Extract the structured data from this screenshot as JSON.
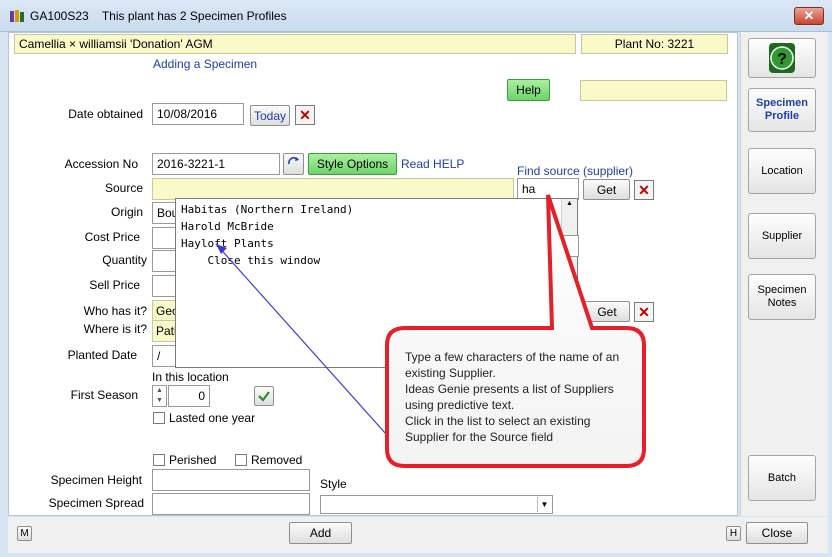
{
  "window": {
    "id": "GA100S23",
    "subtitle": "This plant has 2 Specimen Profiles",
    "close": "✕"
  },
  "header": {
    "plant_name": "Camellia × williamsii 'Donation' AGM",
    "plant_no": "Plant No: 3221",
    "mode": "Adding a Specimen"
  },
  "buttons": {
    "help": "Help",
    "today": "Today",
    "style_options": "Style Options",
    "get": "Get",
    "get2": "Get",
    "add": "Add",
    "close": "Close",
    "m": "M",
    "h": "H"
  },
  "fields": {
    "date_obtained": {
      "label": "Date obtained",
      "value": "10/08/2016"
    },
    "accession_no": {
      "label": "Accession No",
      "value": "2016-3221-1"
    },
    "source": {
      "label": "Source",
      "value": ""
    },
    "origin": {
      "label": "Origin",
      "value": "Bou"
    },
    "cost_price": {
      "label": "Cost Price",
      "value": ""
    },
    "quantity": {
      "label": "Quantity",
      "value": ""
    },
    "sell_price": {
      "label": "Sell Price",
      "value": ""
    },
    "who_has_it": {
      "label": "Who has it?",
      "value": "Geo"
    },
    "where_is_it": {
      "label": "Where is it?",
      "value": "Pati"
    },
    "planted_date": {
      "label": "Planted Date",
      "value": "/"
    },
    "first_season": {
      "label": "First Season",
      "value": "0"
    },
    "specimen_height": {
      "label": "Specimen Height",
      "value": ""
    },
    "specimen_spread": {
      "label": "Specimen Spread",
      "value": ""
    },
    "style": {
      "label": "Style",
      "value": ""
    },
    "find_source": {
      "value": "ha"
    }
  },
  "links": {
    "read_help": "Read HELP",
    "find_source": "Find source (supplier)"
  },
  "labels": {
    "in_this_location": "In this location",
    "lasted_one_year": "Lasted one year",
    "perished": "Perished",
    "removed": "Removed"
  },
  "dropdown": {
    "items": [
      "Habitas (Northern Ireland)",
      "Harold McBride",
      "Hayloft Plants",
      "    Close this window"
    ]
  },
  "callout": {
    "lines": [
      "Type a few characters of the name of an",
      "existing Supplier.",
      "Ideas Genie presents a list of Suppliers",
      "using predictive text.",
      "Click in the list to select an existing",
      "Supplier for the Source field"
    ]
  },
  "sidebar": {
    "specimen_profile": "Specimen Profile",
    "location": "Location",
    "supplier": "Supplier",
    "specimen_notes": "Specimen Notes",
    "batch": "Batch"
  },
  "icons": {
    "help_icon": "question-mark-icon",
    "check": "check-icon",
    "refresh": "refresh-icon"
  }
}
